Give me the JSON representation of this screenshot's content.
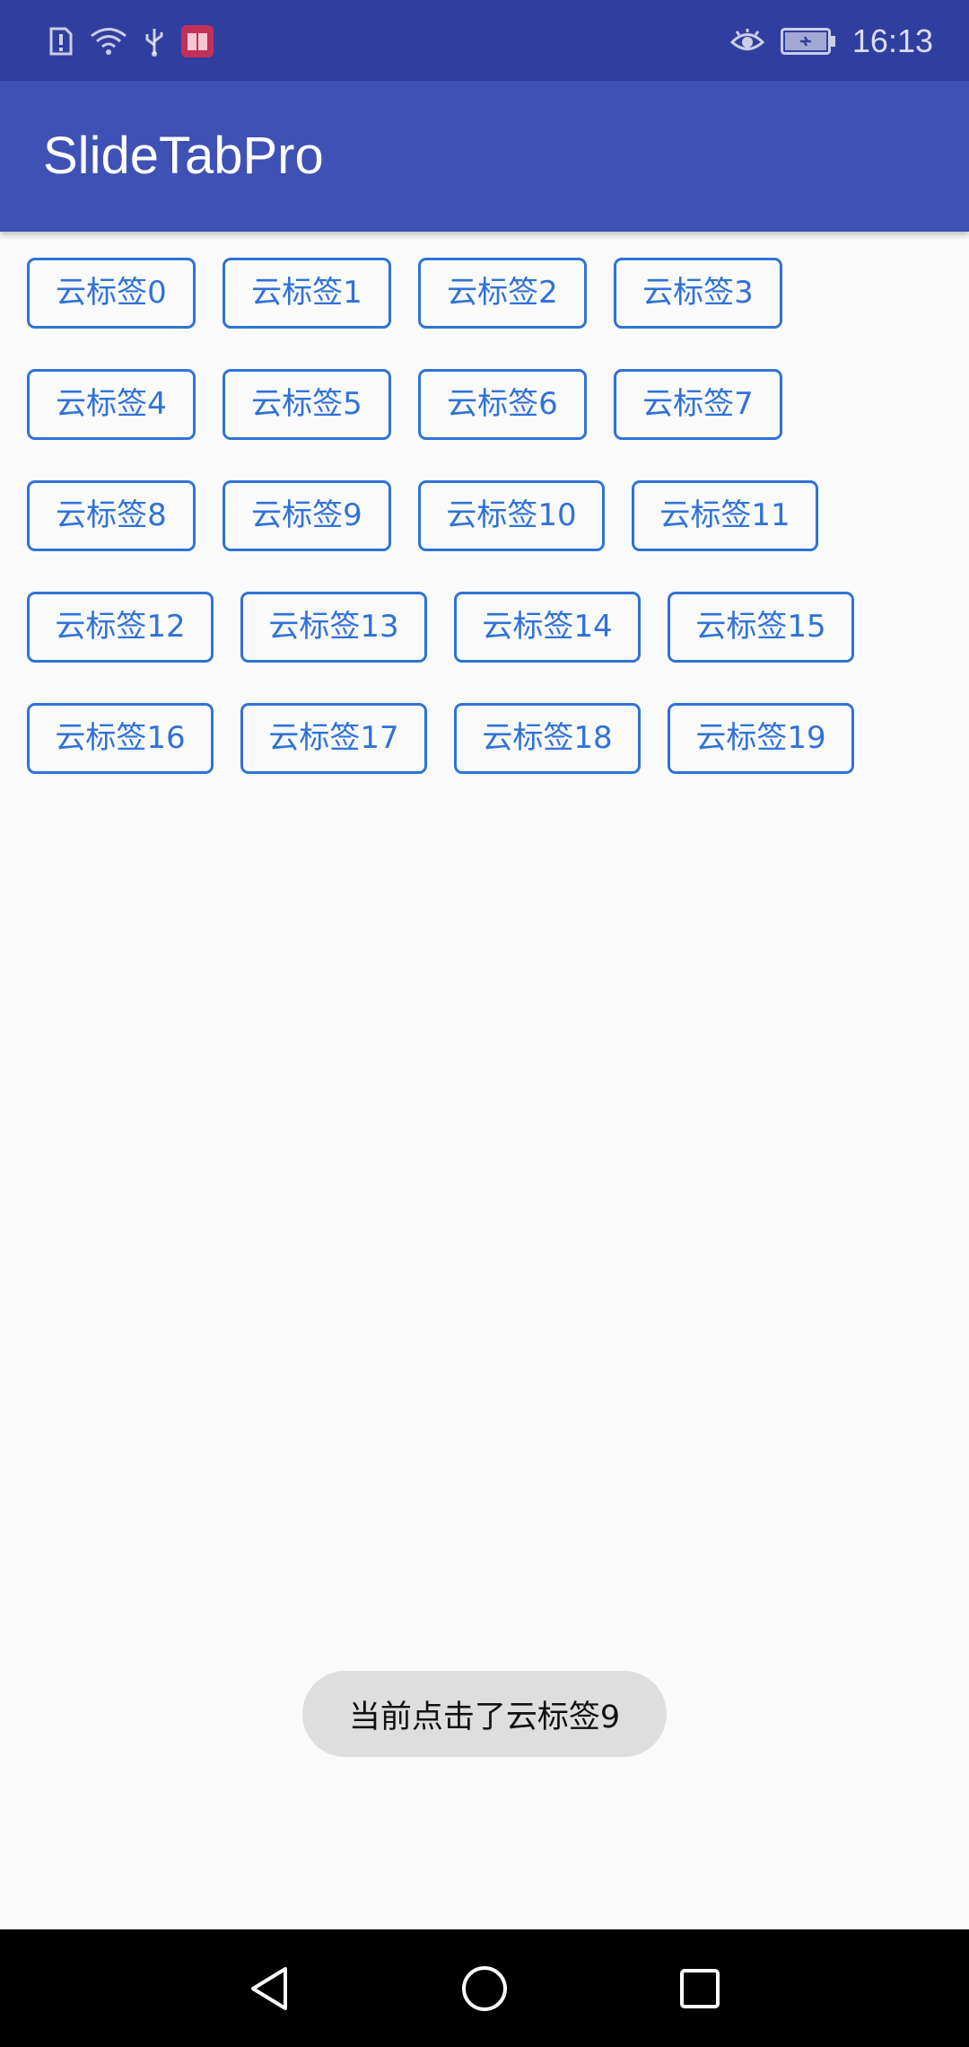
{
  "status_bar": {
    "time": "16:13",
    "icons": [
      "sim-alert-icon",
      "wifi-icon",
      "usb-icon",
      "book-app-icon",
      "eye-comfort-icon",
      "battery-charging-icon"
    ]
  },
  "app_bar": {
    "title": "SlideTabPro"
  },
  "tags": [
    "云标签0",
    "云标签1",
    "云标签2",
    "云标签3",
    "云标签4",
    "云标签5",
    "云标签6",
    "云标签7",
    "云标签8",
    "云标签9",
    "云标签10",
    "云标签11",
    "云标签12",
    "云标签13",
    "云标签14",
    "云标签15",
    "云标签16",
    "云标签17",
    "云标签18",
    "云标签19"
  ],
  "toast": {
    "message": "当前点击了云标签9"
  },
  "nav_bar": {
    "buttons": [
      "back-icon",
      "home-icon",
      "recents-icon"
    ]
  },
  "colors": {
    "status_bar": "#303f9f",
    "app_bar": "#3f51b5",
    "tag_accent": "#2f72d8",
    "background": "#fafafa",
    "toast_bg": "#dedede"
  }
}
